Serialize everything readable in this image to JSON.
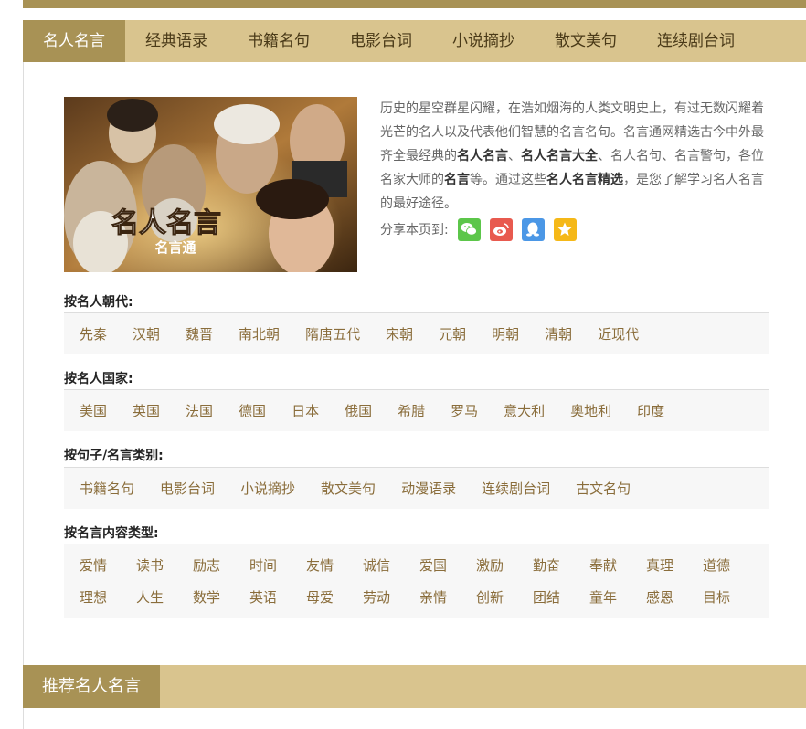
{
  "tabs": [
    "名人名言",
    "经典语录",
    "书籍名句",
    "电影台词",
    "小说摘抄",
    "散文美句",
    "连续剧台词"
  ],
  "hero": {
    "title": "名人名言",
    "subtitle": "名言通"
  },
  "intro": {
    "p1": "历史的星空群星闪耀，在浩如烟海的人类文明史上，有过无数闪耀着光芒的名人以及代表他们智慧的名言名句。名言通网精选古今中外最齐全最经典的",
    "b1": "名人名言",
    "p2": "、",
    "b2": "名人名言大全",
    "p3": "、名人名句、名言警句，各位名家大师的",
    "b3": "名言",
    "p4": "等。通过这些",
    "b4": "名人名言精选",
    "p5": "，是您了解学习名人名言的最好途径。"
  },
  "share": {
    "label": "分享本页到:",
    "icons": [
      {
        "name": "wechat-icon",
        "color": "#5cc64a"
      },
      {
        "name": "weibo-icon",
        "color": "#e85a4f"
      },
      {
        "name": "qq-icon",
        "color": "#4b97e6"
      },
      {
        "name": "qzone-icon",
        "color": "#f5b818"
      }
    ]
  },
  "sections": [
    {
      "title": "按名人朝代:",
      "rows": [
        [
          "先秦",
          "汉朝",
          "魏晋",
          "南北朝",
          "隋唐五代",
          "宋朝",
          "元朝",
          "明朝",
          "清朝",
          "近现代"
        ]
      ]
    },
    {
      "title": "按名人国家:",
      "rows": [
        [
          "美国",
          "英国",
          "法国",
          "德国",
          "日本",
          "俄国",
          "希腊",
          "罗马",
          "意大利",
          "奥地利",
          "印度"
        ]
      ]
    },
    {
      "title": "按句子/名言类别:",
      "rows": [
        [
          "书籍名句",
          "电影台词",
          "小说摘抄",
          "散文美句",
          "动漫语录",
          "连续剧台词",
          "古文名句"
        ]
      ]
    },
    {
      "title": "按名言内容类型:",
      "rows": [
        [
          "爱情",
          "读书",
          "励志",
          "时间",
          "友情",
          "诚信",
          "爱国",
          "激励",
          "勤奋",
          "奉献",
          "真理",
          "道德"
        ],
        [
          "理想",
          "人生",
          "数学",
          "英语",
          "母爱",
          "劳动",
          "亲情",
          "创新",
          "团结",
          "童年",
          "感恩",
          "目标"
        ]
      ]
    }
  ],
  "recommend": {
    "title": "推荐名人名言"
  }
}
